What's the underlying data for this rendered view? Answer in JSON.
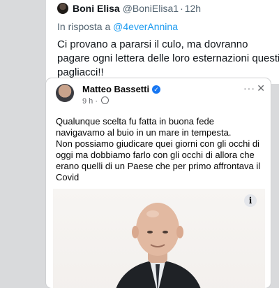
{
  "tweet": {
    "author_name": "Boni Elisa",
    "handle": "@BoniElisa1",
    "separator": "·",
    "time": "12h",
    "reply_prefix": "In risposta a",
    "reply_to": "@4everAnnina",
    "text": "Ci provano a pararsi il culo, ma dovranno pagare ogni lettera delle loro esternazioni questi pagliacci!!"
  },
  "post": {
    "author_name": "Matteo Bassetti",
    "verified_glyph": "✓",
    "time": "9 h ·",
    "more_glyph": "···",
    "close_glyph": "✕",
    "info_glyph": "i",
    "paragraph_1": "Qualunque scelta fu fatta in buona fede navigavamo al buio in un mare in tempesta.",
    "paragraph_2": "Non possiamo giudicare quei giorni con gli occhi di oggi ma dobbiamo farlo con gli occhi di allora che erano quelli di un Paese che per primo affrontava il Covid",
    "icons": [
      "avatar",
      "verified-badge-icon",
      "globe-icon",
      "more-icon",
      "close-icon",
      "info-icon"
    ]
  },
  "colors": {
    "twitter_link": "#1d9bf0",
    "facebook_blue": "#1877f2",
    "muted_text": "#536471"
  }
}
